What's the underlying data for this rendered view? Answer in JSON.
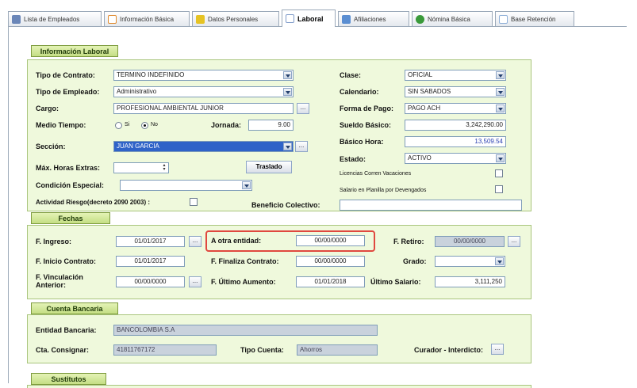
{
  "tabs": [
    {
      "label": "Lista de Empleados",
      "icon": "list-icon",
      "color": "#6a86b8"
    },
    {
      "label": "Información Básica",
      "icon": "id-card-icon",
      "color": "#e08b2f"
    },
    {
      "label": "Datos Personales",
      "icon": "folder-icon",
      "color": "#e6c324"
    },
    {
      "label": "Laboral",
      "icon": "document-icon",
      "color": "#7f9bc9"
    },
    {
      "label": "Afiliaciones",
      "icon": "building-icon",
      "color": "#5a8ed2"
    },
    {
      "label": "Nómina Básica",
      "icon": "money-icon",
      "color": "#3a9a3a"
    },
    {
      "label": "Base Retención",
      "icon": "sheet-icon",
      "color": "#8fb0d8"
    }
  ],
  "laboral": {
    "title": "Información Laboral",
    "tipo_contrato": {
      "label": "Tipo de Contrato:",
      "value": "TERMINO INDEFINIDO"
    },
    "tipo_empleado": {
      "label": "Tipo de Empleado:",
      "value": "Administrativo"
    },
    "cargo": {
      "label": "Cargo:",
      "value": "PROFESIONAL AMBIENTAL JUNIOR"
    },
    "medio_tiempo": {
      "label": "Medio Tiempo:",
      "opt_si": "Si",
      "opt_no": "No",
      "selected": "No"
    },
    "jornada": {
      "label": "Jornada:",
      "value": "9.00"
    },
    "seccion": {
      "label": "Sección:",
      "value": "JUAN GARCIA"
    },
    "max_horas": {
      "label": "Máx. Horas Extras:",
      "value": ""
    },
    "traslado_label": "Traslado",
    "condicion": {
      "label": "Condición Especial:",
      "value": ""
    },
    "actividad_riesgo": {
      "label": "Actividad Riesgo(decreto 2090 2003) :",
      "checked": false
    },
    "beneficio": {
      "label": "Beneficio Colectivo:",
      "value": ""
    },
    "clase": {
      "label": "Clase:",
      "value": "OFICIAL"
    },
    "calendario": {
      "label": "Calendario:",
      "value": "SIN SABADOS"
    },
    "forma_pago": {
      "label": "Forma de Pago:",
      "value": "PAGO ACH"
    },
    "sueldo": {
      "label": "Sueldo Básico:",
      "value": "3,242,290.00"
    },
    "basico_hora": {
      "label": "Básico Hora:",
      "value": "13,509.54"
    },
    "estado": {
      "label": "Estado:",
      "value": "ACTIVO"
    },
    "licencias": {
      "label": "Licencias Corren Vacaciones",
      "checked": false
    },
    "salario_planilla": {
      "label": "Salario en Planilla por Devengados",
      "checked": false
    }
  },
  "fechas": {
    "title": "Fechas",
    "ingreso": {
      "label": "F. Ingreso:",
      "value": "01/01/2017"
    },
    "otra_entidad": {
      "label": "A otra entidad:",
      "value": "00/00/0000"
    },
    "retiro": {
      "label": "F. Retiro:",
      "value": "00/00/0000"
    },
    "inicio_contrato": {
      "label": "F. Inicio Contrato:",
      "value": "01/01/2017"
    },
    "finaliza_contrato": {
      "label": "F. Finaliza Contrato:",
      "value": "00/00/0000"
    },
    "grado": {
      "label": "Grado:",
      "value": ""
    },
    "vinculacion": {
      "label": "F. Vinculación Anterior:",
      "value": "00/00/0000"
    },
    "ultimo_aumento": {
      "label": "F. Último Aumento:",
      "value": "01/01/2018"
    },
    "ultimo_salario": {
      "label": "Último Salario:",
      "value": "3,111,250"
    }
  },
  "cuenta": {
    "title": "Cuenta Bancaria",
    "entidad": {
      "label": "Entidad Bancaria:",
      "value": "BANCOLOMBIA S.A"
    },
    "consignar": {
      "label": "Cta. Consignar:",
      "value": "41811767172"
    },
    "tipo": {
      "label": "Tipo Cuenta:",
      "value": "Ahorros"
    },
    "curador": {
      "label": "Curador - Interdicto:"
    }
  },
  "sustitutos": {
    "title": "Sustitutos"
  },
  "dots_label": "...",
  "colors": {
    "section_bg": "#eff9dc",
    "section_title": "#c4de84",
    "highlight": "#e0483f",
    "selected": "#2f63c8"
  }
}
